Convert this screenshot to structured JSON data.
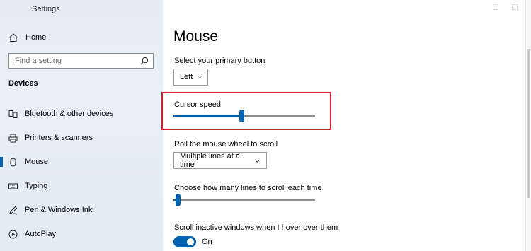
{
  "window": {
    "title": "Settings"
  },
  "sidebar": {
    "home_label": "Home",
    "search_placeholder": "Find a setting",
    "section": "Devices",
    "items": [
      {
        "label": "Bluetooth & other devices",
        "icon": "bluetooth-device-icon"
      },
      {
        "label": "Printers & scanners",
        "icon": "printer-icon"
      },
      {
        "label": "Mouse",
        "icon": "mouse-icon",
        "active": true
      },
      {
        "label": "Typing",
        "icon": "keyboard-icon"
      },
      {
        "label": "Pen & Windows Ink",
        "icon": "pen-icon"
      },
      {
        "label": "AutoPlay",
        "icon": "autoplay-icon"
      }
    ]
  },
  "main": {
    "title": "Mouse",
    "primary_button": {
      "label": "Select your primary button",
      "value": "Left"
    },
    "cursor_speed": {
      "label": "Cursor speed",
      "value_fraction": 0.48
    },
    "scroll_wheel": {
      "label": "Roll the mouse wheel to scroll",
      "value": "Multiple lines at a time"
    },
    "lines_to_scroll": {
      "label": "Choose how many lines to scroll each time",
      "value_fraction": 0.03
    },
    "inactive_scroll": {
      "label": "Scroll inactive windows when I hover over them",
      "state": "On"
    }
  },
  "colors": {
    "accent": "#0063b1",
    "highlight": "#d0202e",
    "sidebar_bg": "#e6eef4"
  }
}
